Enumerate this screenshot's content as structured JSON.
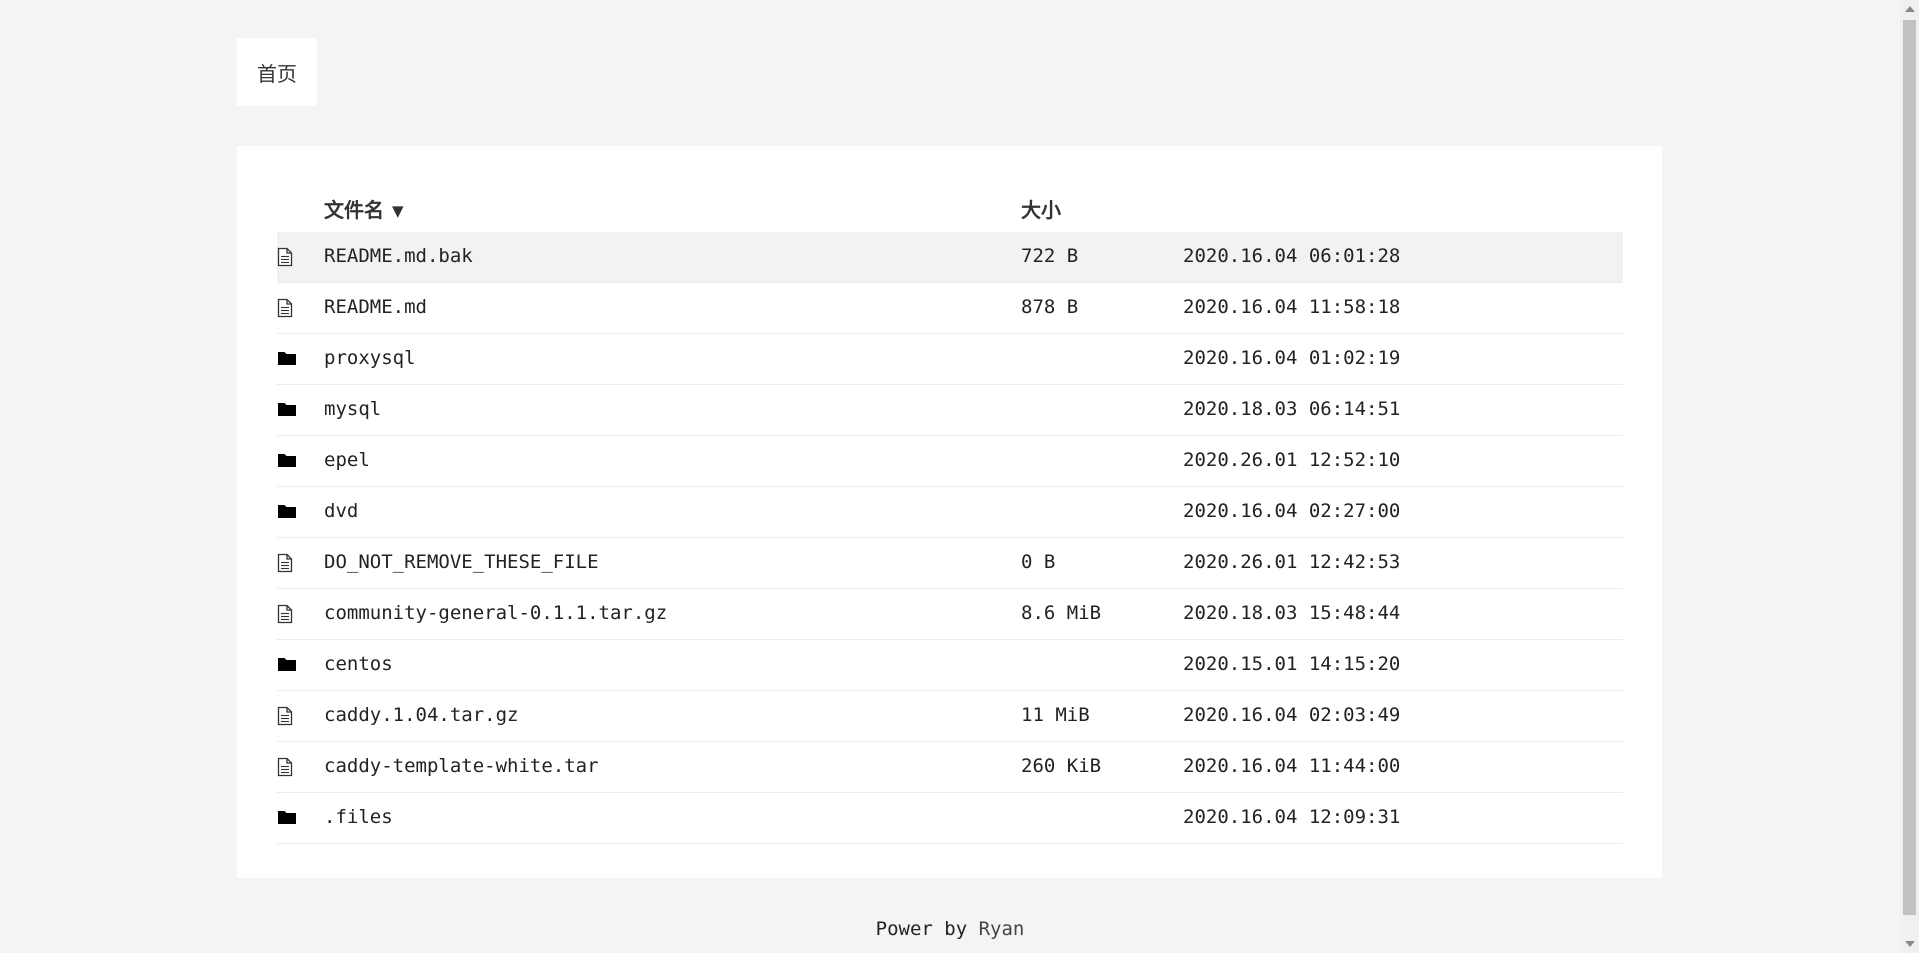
{
  "breadcrumb": {
    "home_label": "首页"
  },
  "table": {
    "headers": {
      "name": "文件名",
      "sort_indicator": "▼",
      "size": "大小"
    },
    "rows": [
      {
        "type": "file",
        "icon": "file-icon",
        "name": "README.md.bak",
        "size": "722 B",
        "date": "2020.16.04 06:01:28"
      },
      {
        "type": "file",
        "icon": "file-icon",
        "name": "README.md",
        "size": "878 B",
        "date": "2020.16.04 11:58:18"
      },
      {
        "type": "folder",
        "icon": "folder-icon",
        "name": "proxysql",
        "size": "",
        "date": "2020.16.04 01:02:19"
      },
      {
        "type": "folder",
        "icon": "folder-icon",
        "name": "mysql",
        "size": "",
        "date": "2020.18.03 06:14:51"
      },
      {
        "type": "folder",
        "icon": "folder-icon",
        "name": "epel",
        "size": "",
        "date": "2020.26.01 12:52:10"
      },
      {
        "type": "folder",
        "icon": "folder-icon",
        "name": "dvd",
        "size": "",
        "date": "2020.16.04 02:27:00"
      },
      {
        "type": "file",
        "icon": "file-icon",
        "name": "DO_NOT_REMOVE_THESE_FILE",
        "size": "0 B",
        "date": "2020.26.01 12:42:53"
      },
      {
        "type": "file",
        "icon": "file-icon",
        "name": "community-general-0.1.1.tar.gz",
        "size": "8.6 MiB",
        "date": "2020.18.03 15:48:44"
      },
      {
        "type": "folder",
        "icon": "folder-icon",
        "name": "centos",
        "size": "",
        "date": "2020.15.01 14:15:20"
      },
      {
        "type": "file",
        "icon": "file-icon",
        "name": "caddy.1.04.tar.gz",
        "size": "11 MiB",
        "date": "2020.16.04 02:03:49"
      },
      {
        "type": "file",
        "icon": "file-icon",
        "name": "caddy-template-white.tar",
        "size": "260 KiB",
        "date": "2020.16.04 11:44:00"
      },
      {
        "type": "folder",
        "icon": "folder-icon",
        "name": ".files",
        "size": "",
        "date": "2020.16.04 12:09:31"
      }
    ]
  },
  "footer": {
    "prefix": "Power by",
    "author": "Ryan"
  },
  "colors": {
    "page_bg": "#f4f4f4",
    "card_bg": "#ffffff",
    "row_highlight": "#f2f2f2"
  }
}
